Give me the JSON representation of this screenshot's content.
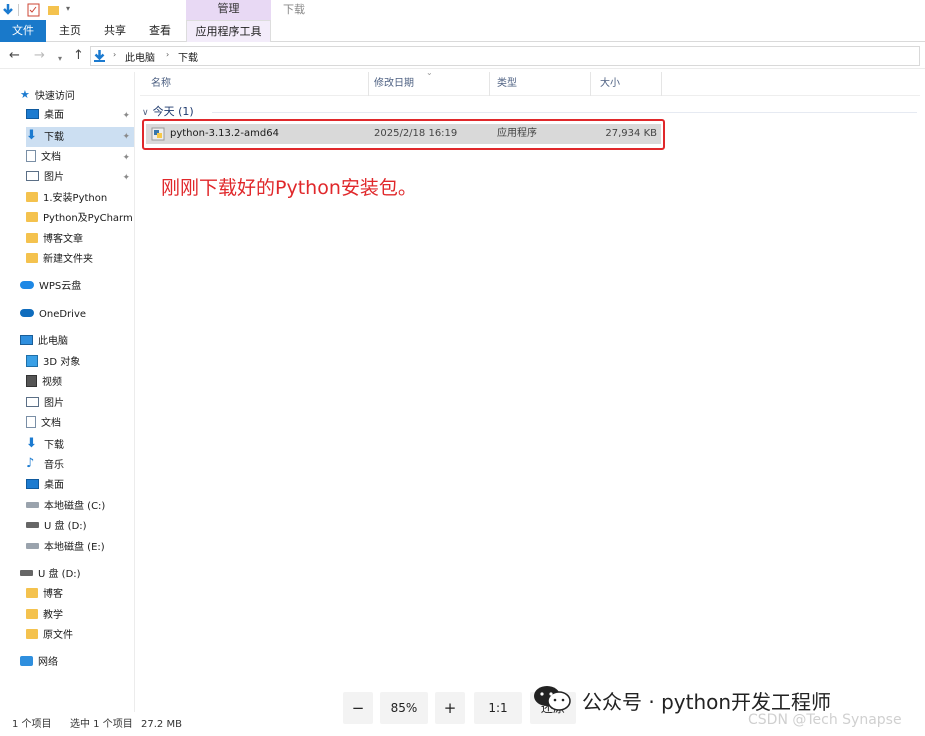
{
  "titlebar": {
    "manage_tab": "管理",
    "location_title": "下载"
  },
  "ribbon": {
    "tabs": [
      "文件",
      "主页",
      "共享",
      "查看",
      "应用程序工具"
    ]
  },
  "address": {
    "path": [
      "此电脑",
      "下载"
    ]
  },
  "sidebar": {
    "quick_access": "快速访问",
    "quick_items": [
      "桌面",
      "下载",
      "文档",
      "图片",
      "1.安装Python",
      "Python及PyCharm",
      "博客文章",
      "新建文件夹"
    ],
    "wps": "WPS云盘",
    "onedrive": "OneDrive",
    "this_pc": "此电脑",
    "pc_items": [
      "3D 对象",
      "视频",
      "图片",
      "文档",
      "下载",
      "音乐",
      "桌面",
      "本地磁盘 (C:)",
      "U 盘 (D:)",
      "本地磁盘 (E:)"
    ],
    "usb": "U 盘 (D:)",
    "usb_items": [
      "博客",
      "教学",
      "原文件"
    ],
    "network": "网络"
  },
  "columns": {
    "name": "名称",
    "modified": "修改日期",
    "type": "类型",
    "size": "大小"
  },
  "group": {
    "label": "今天 (1)"
  },
  "file": {
    "name": "python-3.13.2-amd64",
    "modified": "2025/2/18 16:19",
    "type": "应用程序",
    "size": "27,934 KB"
  },
  "annotation": "刚刚下载好的Python安装包。",
  "status": {
    "count": "1 个项目",
    "selected": "选中 1 个项目",
    "selected_size": "27.2 MB"
  },
  "zoom_toolbar": {
    "minus": "−",
    "zoom": "85%",
    "plus": "+",
    "actual": "1:1",
    "restore": "还原"
  },
  "watermark": {
    "wechat": "公众号 · python开发工程师",
    "csdn": "CSDN @Tech Synapse"
  }
}
